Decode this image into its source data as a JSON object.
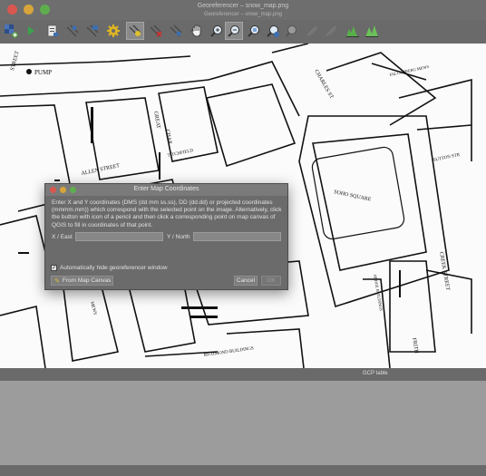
{
  "window": {
    "title": "Georeferencer – snow_map.png",
    "subtitle": "Georeferencer – snow_map.png"
  },
  "toolbar": {
    "buttons": [
      {
        "name": "add-raster-icon"
      },
      {
        "name": "start-georeferencing-icon"
      },
      {
        "name": "generate-gdal-script-icon"
      },
      {
        "name": "load-gcp-points-icon"
      },
      {
        "name": "save-gcp-points-icon"
      },
      {
        "name": "transformation-settings-icon"
      },
      {
        "name": "add-point-icon"
      },
      {
        "name": "delete-point-icon"
      },
      {
        "name": "move-gcp-point-icon"
      },
      {
        "name": "pan-icon"
      },
      {
        "name": "zoom-in-icon"
      },
      {
        "name": "zoom-out-icon"
      },
      {
        "name": "zoom-to-layer-icon"
      },
      {
        "name": "zoom-last-icon"
      },
      {
        "name": "zoom-next-icon"
      },
      {
        "name": "link-georeferencer-icon"
      },
      {
        "name": "link-qgis-icon"
      },
      {
        "name": "full-histogram-stretch-icon"
      },
      {
        "name": "local-histogram-stretch-icon"
      }
    ]
  },
  "map_labels": {
    "pump": "PUMP",
    "street": "STREET",
    "charles_st": "CHARLES ST",
    "falconberg_mews": "FALCONBERG MEWS",
    "sutton_str": "SUTTON STR",
    "soho_square": "SOHO SQUARE",
    "allen_street": "ALLEN STREET",
    "great": "GREAT",
    "chapel": "CHAP",
    "titchfield": "TITCHFIELD",
    "creek_street": "CREEK STREET",
    "frith": "FRITH",
    "richmond_buildings": "RICHMOND BUILDINGS",
    "hedge_buildings": "HEDGE BUILDINGS",
    "mews": "MEWS"
  },
  "gcp_table": {
    "title": "GCP table"
  },
  "dialog": {
    "title": "Enter Map Coordinates",
    "instructions": "Enter X and Y coordinates (DMS (dd mm ss.ss), DD (dd.dd) or projected coordinates (mmmm.mm)) which correspond with the selected point on the image. Alternatively, click the button with icon of a pencil and then click a corresponding point on map canvas of QGIS to fill in coordinates of that point.",
    "x_label": "X / East",
    "y_label": "Y / North",
    "x_value": "",
    "y_value": "",
    "auto_hide_label": "Automatically hide georeferencer window",
    "auto_hide_checked": true,
    "from_map_canvas_label": "From Map Canvas",
    "cancel_label": "Cancel",
    "ok_label": "OK"
  },
  "colors": {
    "titlebar": "#6e6e6e",
    "toolbar": "#6a6a6a",
    "dialog_bg": "#6b6b6b",
    "map_bg": "#fbfbfb",
    "close": "#d9574f",
    "minimize": "#d8a53a",
    "maximize": "#5fae4e"
  }
}
